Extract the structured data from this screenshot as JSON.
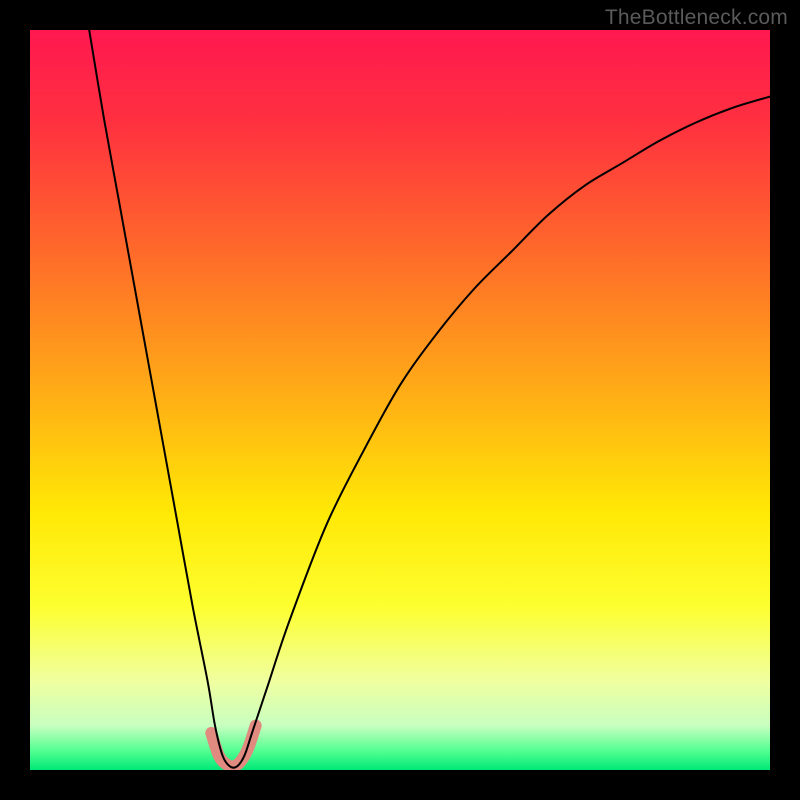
{
  "watermark": "TheBottleneck.com",
  "chart_data": {
    "type": "line",
    "title": "",
    "xlabel": "",
    "ylabel": "",
    "xlim": [
      0,
      100
    ],
    "ylim": [
      0,
      100
    ],
    "background_gradient": {
      "stops": [
        {
          "pos": 0.0,
          "color": "#ff1850"
        },
        {
          "pos": 0.12,
          "color": "#ff2f40"
        },
        {
          "pos": 0.3,
          "color": "#ff6a2a"
        },
        {
          "pos": 0.5,
          "color": "#ffb015"
        },
        {
          "pos": 0.65,
          "color": "#ffe805"
        },
        {
          "pos": 0.78,
          "color": "#fdff30"
        },
        {
          "pos": 0.88,
          "color": "#f0ffa0"
        },
        {
          "pos": 0.94,
          "color": "#c8ffc0"
        },
        {
          "pos": 0.975,
          "color": "#50ff90"
        },
        {
          "pos": 1.0,
          "color": "#00e878"
        }
      ]
    },
    "series": [
      {
        "name": "bottleneck-curve",
        "color": "#000000",
        "width": 2,
        "x": [
          8,
          10,
          12,
          14,
          16,
          18,
          20,
          22,
          24,
          25,
          26,
          27,
          28,
          29,
          30,
          32,
          35,
          40,
          45,
          50,
          55,
          60,
          65,
          70,
          75,
          80,
          85,
          90,
          95,
          100
        ],
        "y": [
          100,
          88,
          77,
          66,
          55,
          44,
          33,
          22,
          12,
          6,
          2,
          0.5,
          0.5,
          2,
          5,
          11,
          20,
          33,
          43,
          52,
          59,
          65,
          70,
          75,
          79,
          82,
          85,
          87.5,
          89.5,
          91
        ]
      },
      {
        "name": "marker-band",
        "color": "#e08a80",
        "width": 12,
        "cap": "round",
        "x": [
          24.5,
          25.5,
          26.5,
          27.5,
          28.5,
          29.5,
          30.5
        ],
        "y": [
          5,
          2,
          0.8,
          0.5,
          1.2,
          3,
          6
        ]
      }
    ],
    "minimum_x": 27,
    "minimum_y": 0.5
  }
}
